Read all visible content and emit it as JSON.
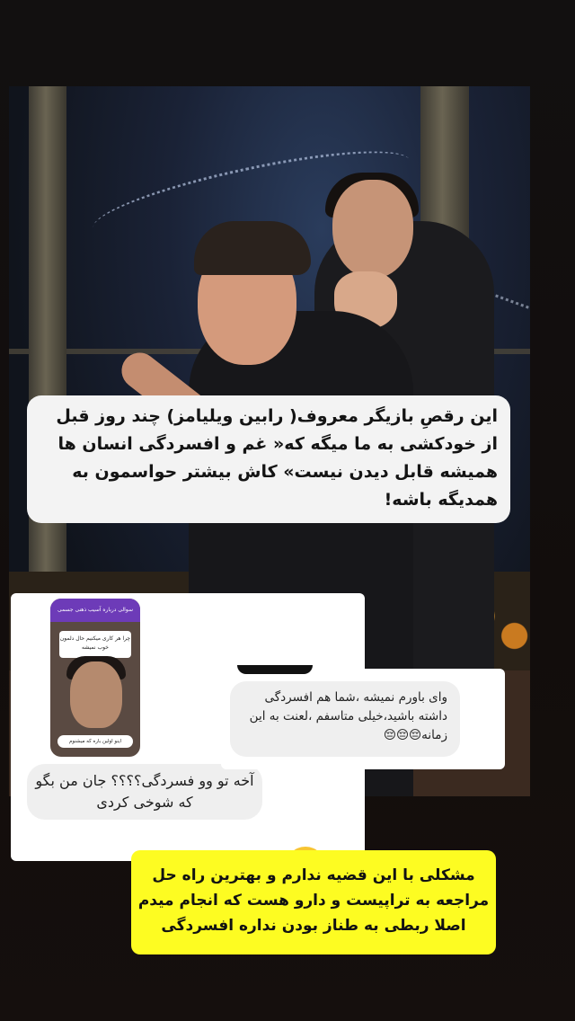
{
  "caption": {
    "text": "این رقصِ بازیگر معروف( رابین ویلیامز) چند روز قبل از خودکشی به ما میگه که« غم و افسردگی انسان ها همیشه قابل دیدن نیست» کاش بیشتر حواسمون به همدیگه باشه!"
  },
  "comment_left": {
    "text": "آخه تو وو فسردگی؟؟؟؟ جان من بگو که شوخی کردی",
    "thumbnail": {
      "question": "سوالی درباره آسیب ذهنی جسمی",
      "answer": "چرا هر کاری میکنیم حال دلمون خوب نمیشه",
      "caption": "اینو اولین باره که میشنوم"
    }
  },
  "comment_right": {
    "text": "وای باورم نمیشه ،شما هم افسردگی داشته باشید،خیلی متاسفم ،لعنت به این زمانه😔😔😔"
  },
  "reply": {
    "text": "مشکلی با این قضیه ندارم و بهترین راه حل مراجعه به تراپیست و دارو هست که انجام میدم اصلا ربطی به طناز بودن نداره افسردگی",
    "color": "#fdfc22"
  },
  "colors": {
    "background": "#120d0c",
    "caption_bg": "#f3f3f3",
    "bubble_bg": "#efefef"
  }
}
